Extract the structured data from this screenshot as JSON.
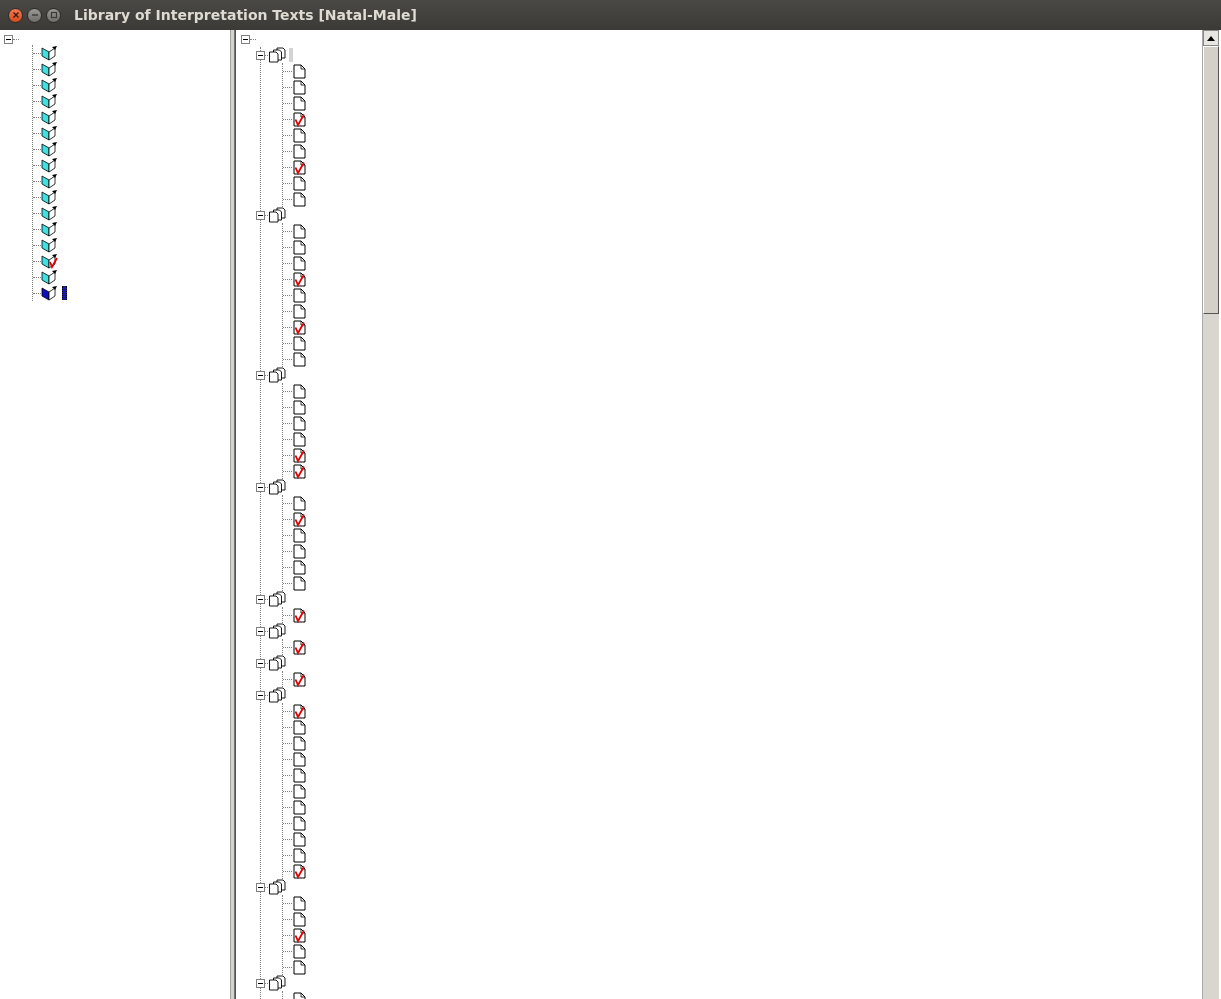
{
  "window": {
    "title": "Library of Interpretation Texts [Natal-Male]"
  },
  "left_tree": {
    "root": {
      "expanded": true,
      "children": [
        {
          "checked": false,
          "selected": false
        },
        {
          "checked": false,
          "selected": false
        },
        {
          "checked": false,
          "selected": false
        },
        {
          "checked": false,
          "selected": false
        },
        {
          "checked": false,
          "selected": false
        },
        {
          "checked": false,
          "selected": false
        },
        {
          "checked": false,
          "selected": false
        },
        {
          "checked": false,
          "selected": false
        },
        {
          "checked": false,
          "selected": false
        },
        {
          "checked": false,
          "selected": false
        },
        {
          "checked": false,
          "selected": false
        },
        {
          "checked": false,
          "selected": false
        },
        {
          "checked": false,
          "selected": false
        },
        {
          "checked": true,
          "selected": false
        },
        {
          "checked": false,
          "selected": false
        },
        {
          "checked": false,
          "selected": true
        }
      ]
    }
  },
  "right_tree": {
    "root": {
      "expanded": true,
      "children": [
        {
          "expanded": true,
          "selected": true,
          "children": [
            {
              "checked": false
            },
            {
              "checked": false
            },
            {
              "checked": false
            },
            {
              "checked": true
            },
            {
              "checked": false
            },
            {
              "checked": false
            },
            {
              "checked": true
            },
            {
              "checked": false
            },
            {
              "checked": false
            }
          ]
        },
        {
          "expanded": true,
          "selected": false,
          "children": [
            {
              "checked": false
            },
            {
              "checked": false
            },
            {
              "checked": false
            },
            {
              "checked": true
            },
            {
              "checked": false
            },
            {
              "checked": false
            },
            {
              "checked": true
            },
            {
              "checked": false
            },
            {
              "checked": false
            }
          ]
        },
        {
          "expanded": true,
          "selected": false,
          "children": [
            {
              "checked": false
            },
            {
              "checked": false
            },
            {
              "checked": false
            },
            {
              "checked": false
            },
            {
              "checked": true
            },
            {
              "checked": true
            }
          ]
        },
        {
          "expanded": true,
          "selected": false,
          "children": [
            {
              "checked": false
            },
            {
              "checked": true
            },
            {
              "checked": false
            },
            {
              "checked": false
            },
            {
              "checked": false
            },
            {
              "checked": false
            }
          ]
        },
        {
          "expanded": true,
          "selected": false,
          "children": [
            {
              "checked": true
            }
          ]
        },
        {
          "expanded": true,
          "selected": false,
          "children": [
            {
              "checked": true
            }
          ]
        },
        {
          "expanded": true,
          "selected": false,
          "children": [
            {
              "checked": true
            }
          ]
        },
        {
          "expanded": true,
          "selected": false,
          "children": [
            {
              "checked": true
            },
            {
              "checked": false
            },
            {
              "checked": false
            },
            {
              "checked": false
            },
            {
              "checked": false
            },
            {
              "checked": false
            },
            {
              "checked": false
            },
            {
              "checked": false
            },
            {
              "checked": false
            },
            {
              "checked": false
            },
            {
              "checked": true
            }
          ]
        },
        {
          "expanded": true,
          "selected": false,
          "children": [
            {
              "checked": false
            },
            {
              "checked": false
            },
            {
              "checked": true
            },
            {
              "checked": false
            },
            {
              "checked": false
            }
          ]
        },
        {
          "expanded": true,
          "selected": false,
          "children": [
            {
              "checked": false
            }
          ]
        }
      ]
    }
  }
}
